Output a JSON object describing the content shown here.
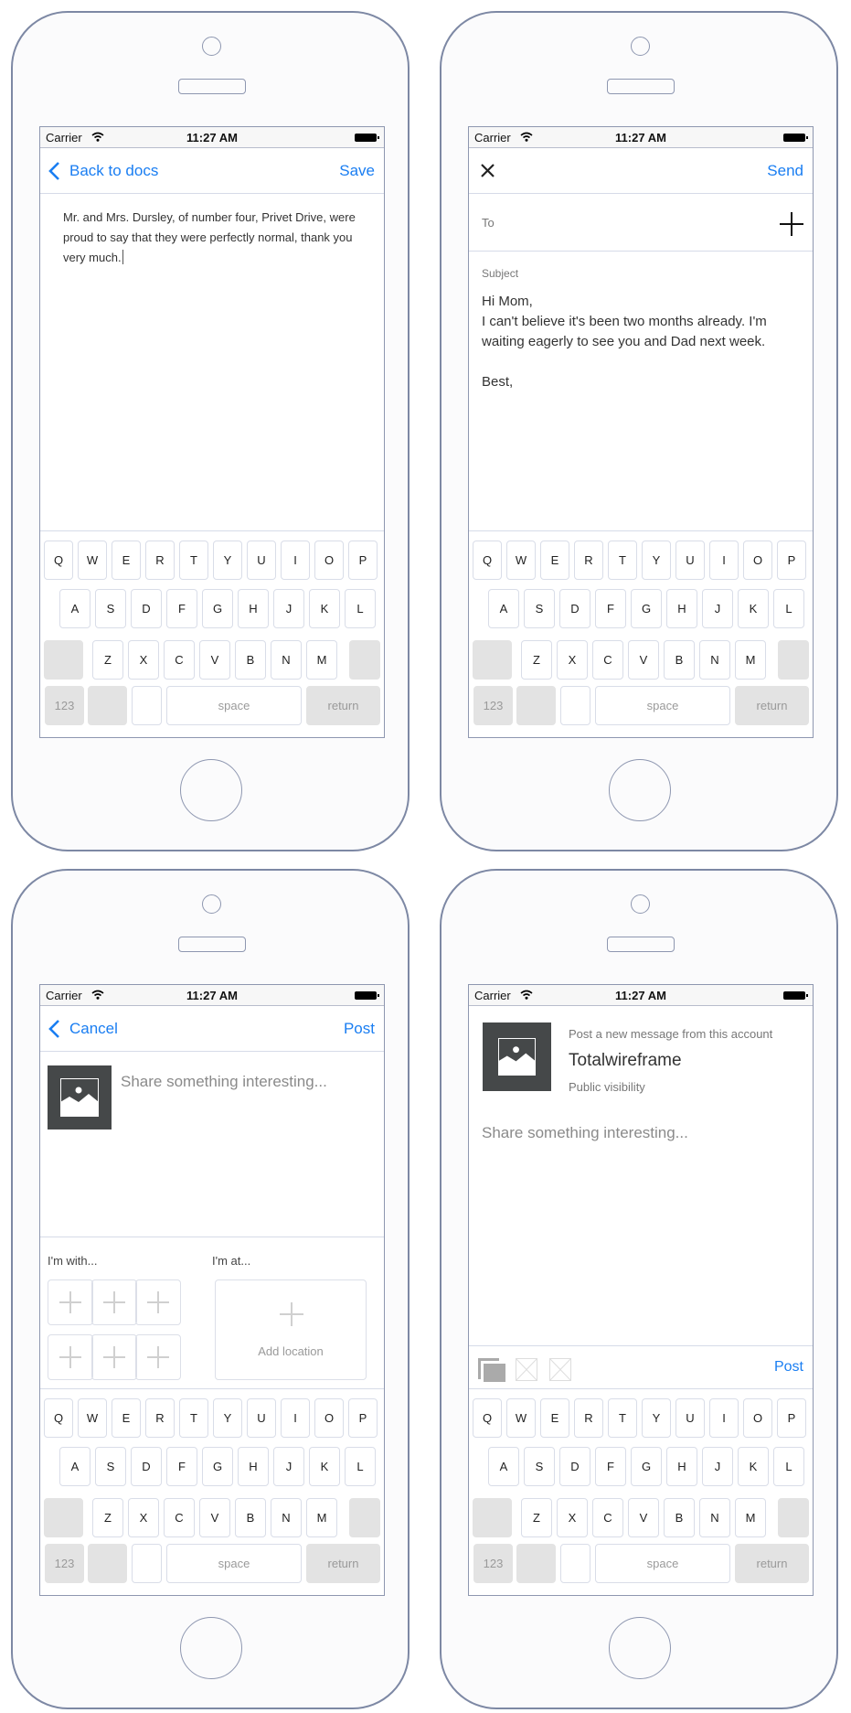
{
  "status_bar": {
    "carrier": "Carrier",
    "time": "11:27 AM"
  },
  "colors": {
    "accent": "#1a7ef2",
    "device_outline": "#7d88a4",
    "placeholder_image": "#454849",
    "key_grey": "#e3e3e3"
  },
  "keyboard": {
    "row1": [
      "Q",
      "W",
      "E",
      "R",
      "T",
      "Y",
      "U",
      "I",
      "O",
      "P"
    ],
    "row2": [
      "A",
      "S",
      "D",
      "F",
      "G",
      "H",
      "J",
      "K",
      "L"
    ],
    "row3": [
      "Z",
      "X",
      "C",
      "V",
      "B",
      "N",
      "M"
    ],
    "numbers_label": "123",
    "space_label": "space",
    "return_label": "return"
  },
  "screens": {
    "document_editor": {
      "back_label": "Back to docs",
      "save_label": "Save",
      "body_text": "Mr. and Mrs. Dursley, of number four, Privet Drive, were proud to say that they were perfectly normal, thank you very much."
    },
    "mail_compose": {
      "send_label": "Send",
      "to_label": "To",
      "subject_placeholder": "Subject",
      "body_lines": [
        "Hi Mom,",
        "I can't believe it's been two months already. I'm waiting eagerly to see you and Dad next week.",
        "",
        "Best,"
      ]
    },
    "social_post": {
      "cancel_label": "Cancel",
      "post_label": "Post",
      "placeholder": "Share something interesting...",
      "with_label": "I'm with...",
      "at_label": "I'm at...",
      "add_location_label": "Add location"
    },
    "account_post": {
      "subtitle": "Post a new message from this account",
      "account_name": "Totalwireframe",
      "visibility": "Public visibility",
      "placeholder": "Share something interesting...",
      "post_label": "Post"
    }
  }
}
